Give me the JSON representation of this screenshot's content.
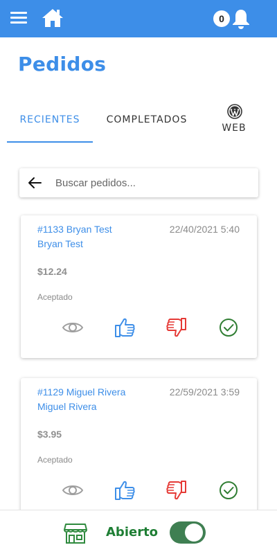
{
  "header": {
    "notification_count": "0",
    "icons": [
      "menu-icon",
      "home-icon",
      "bell-icon"
    ]
  },
  "page": {
    "title": "Pedidos"
  },
  "tabs": [
    {
      "label": "RECIENTES",
      "active": true
    },
    {
      "label": "COMPLETADOS",
      "active": false
    },
    {
      "label": "WEB",
      "active": false,
      "icon": "wordpress-icon"
    }
  ],
  "search": {
    "placeholder": "Buscar pedidos...",
    "value": ""
  },
  "orders": [
    {
      "number": "#1133 Bryan Test",
      "customer": "Bryan Test",
      "date": "22/40/2021 5:40",
      "amount": "$12.24",
      "status": "Aceptado",
      "actions": [
        "eye-icon",
        "thumbs-up-icon",
        "thumbs-down-icon",
        "check-circle-icon"
      ]
    },
    {
      "number": "#1129 Miguel Rivera",
      "customer": "Miguel Rivera",
      "date": "22/59/2021 3:59",
      "amount": "$3.95",
      "status": "Aceptado",
      "actions": [
        "eye-icon",
        "thumbs-up-icon",
        "thumbs-down-icon",
        "check-circle-icon"
      ]
    }
  ],
  "footer": {
    "store_status_label": "Abierto",
    "store_open": true
  },
  "colors": {
    "primary": "#3d8ee8",
    "accept": "#2f7d32",
    "reject": "#e53935",
    "view": "#9e9e9e",
    "open_green": "#1e7e34",
    "toggle_on": "#3f7f52"
  }
}
